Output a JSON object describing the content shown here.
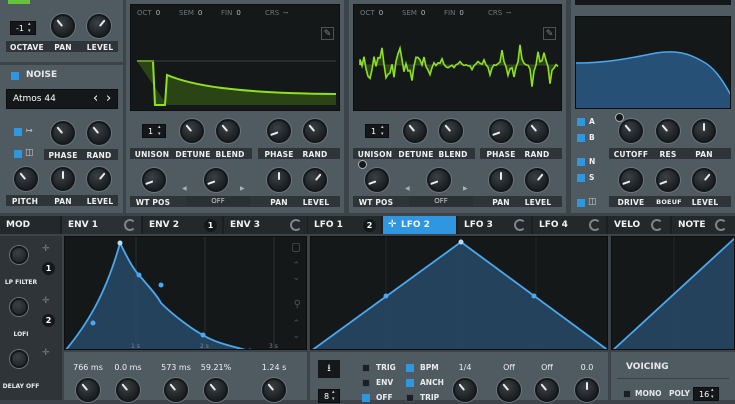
{
  "osc1": {
    "octave_value": "-1",
    "labels": {
      "octave": "OCTAVE",
      "pan": "PAN",
      "level": "LEVEL"
    }
  },
  "noise": {
    "title": "NOISE",
    "preset": "Atmos 44",
    "labels": {
      "phase": "PHASE",
      "rand": "RAND",
      "pitch": "PITCH",
      "pan": "PAN",
      "level": "LEVEL"
    }
  },
  "osc_a": {
    "readout": [
      {
        "k": "OCT",
        "v": "0"
      },
      {
        "k": "SEM",
        "v": "0"
      },
      {
        "k": "FIN",
        "v": "0"
      },
      {
        "k": "CRS",
        "v": "--"
      }
    ],
    "unison_value": "1",
    "labels": {
      "unison": "UNISON",
      "detune": "DETUNE",
      "blend": "BLEND",
      "phase": "PHASE",
      "rand": "RAND",
      "wt_pos": "WT POS",
      "off": "OFF",
      "pan": "PAN",
      "level": "LEVEL"
    }
  },
  "osc_b": {
    "readout": [
      {
        "k": "OCT",
        "v": "0"
      },
      {
        "k": "SEM",
        "v": "0"
      },
      {
        "k": "FIN",
        "v": "0"
      },
      {
        "k": "CRS",
        "v": "--"
      }
    ],
    "unison_value": "1",
    "labels": {
      "unison": "UNISON",
      "detune": "DETUNE",
      "blend": "BLEND",
      "phase": "PHASE",
      "rand": "RAND",
      "wt_pos": "WT POS",
      "off": "OFF",
      "pan": "PAN",
      "level": "LEVEL"
    }
  },
  "filter": {
    "routes": [
      "A",
      "B",
      "N",
      "S"
    ],
    "labels": {
      "cutoff": "CUTOFF",
      "res": "RES",
      "pan": "PAN",
      "drive": "DRIVE",
      "mode": "BOEUF",
      "level": "LEVEL"
    }
  },
  "mod": {
    "title": "MOD",
    "slots": [
      {
        "label": "LP FILTER",
        "count": "1"
      },
      {
        "label": "LOFI",
        "count": "2"
      },
      {
        "label": "DELAY OFF",
        "count": ""
      }
    ]
  },
  "env_tabs": [
    {
      "label": "ENV 1",
      "badge": ""
    },
    {
      "label": "ENV 2",
      "badge": "1"
    },
    {
      "label": "ENV 3",
      "badge": ""
    }
  ],
  "env": {
    "time_marks": [
      "1 s",
      "2 s",
      "3 s"
    ],
    "values": [
      "766 ms",
      "0.0 ms",
      "573 ms",
      "59.21%",
      "1.24 s"
    ]
  },
  "lfo_tabs": [
    {
      "label": "LFO 1",
      "badge": "2"
    },
    {
      "label": "LFO 2",
      "badge": ""
    },
    {
      "label": "LFO 3",
      "badge": ""
    },
    {
      "label": "LFO 4",
      "badge": ""
    }
  ],
  "lfo": {
    "grid_value": "8",
    "modes": [
      {
        "label": "TRIG",
        "on": false
      },
      {
        "label": "ENV",
        "on": false
      },
      {
        "label": "OFF",
        "on": true
      }
    ],
    "options": [
      {
        "label": "BPM",
        "on": true
      },
      {
        "label": "ANCH",
        "on": true
      },
      {
        "label": "TRIP",
        "on": false
      }
    ],
    "values": [
      "1/4",
      "Off",
      "Off",
      "0.0"
    ]
  },
  "velo": {
    "tab": "VELO",
    "note_tab": "NOTE"
  },
  "voicing": {
    "title": "VOICING",
    "mono": "MONO",
    "poly_label": "POLY",
    "poly_value": "16"
  },
  "colors": {
    "accent": "#2f97e0",
    "waveform": "#8fe11f",
    "panel": "#505a61"
  }
}
